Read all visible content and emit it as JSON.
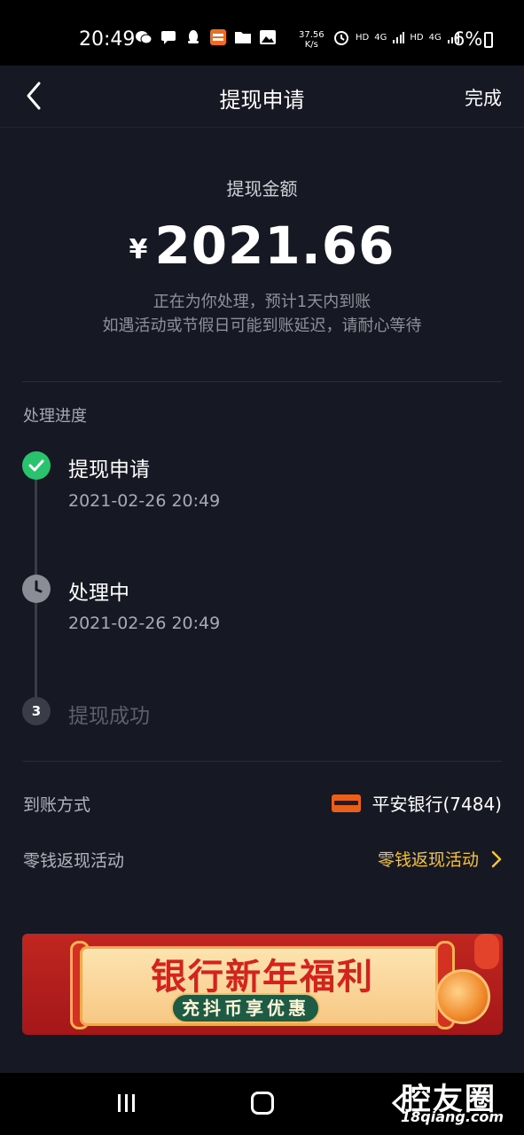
{
  "status_bar": {
    "time": "20:49",
    "net_speed_value": "37.56",
    "net_speed_unit": "K/s",
    "hd1": "HD",
    "net1": "4G",
    "hd2": "HD",
    "net2": "4G",
    "battery": "6%",
    "icons": [
      "wechat-icon",
      "message-icon",
      "qq-icon",
      "pingan-bank-app-icon",
      "folder-icon",
      "gallery-icon",
      "alarm-icon"
    ]
  },
  "nav": {
    "title": "提现申请",
    "done_label": "完成"
  },
  "amount": {
    "label": "提现金额",
    "currency": "¥",
    "value": "2021.66",
    "note_line1": "正在为你处理，预计1天内到账",
    "note_line2": "如遇活动或节假日可能到账延迟，请耐心等待"
  },
  "progress": {
    "section_title": "处理进度",
    "steps": [
      {
        "title": "提现申请",
        "time": "2021-02-26 20:49",
        "state": "done"
      },
      {
        "title": "处理中",
        "time": "2021-02-26 20:49",
        "state": "processing"
      },
      {
        "title": "提现成功",
        "step_number": "3",
        "state": "pending"
      }
    ]
  },
  "payout": {
    "method_label": "到账方式",
    "bank_name": "平安银行(7484)",
    "promo_label": "零钱返现活动",
    "promo_link": "零钱返现活动"
  },
  "banner": {
    "title": "银行新年福利",
    "subtitle": "充抖币享优惠"
  },
  "watermark": {
    "text": "腔友圈",
    "url": "18qiang.com"
  },
  "colors": {
    "background": "#161823",
    "success": "#2ac36d",
    "accent": "#f5c33b"
  }
}
